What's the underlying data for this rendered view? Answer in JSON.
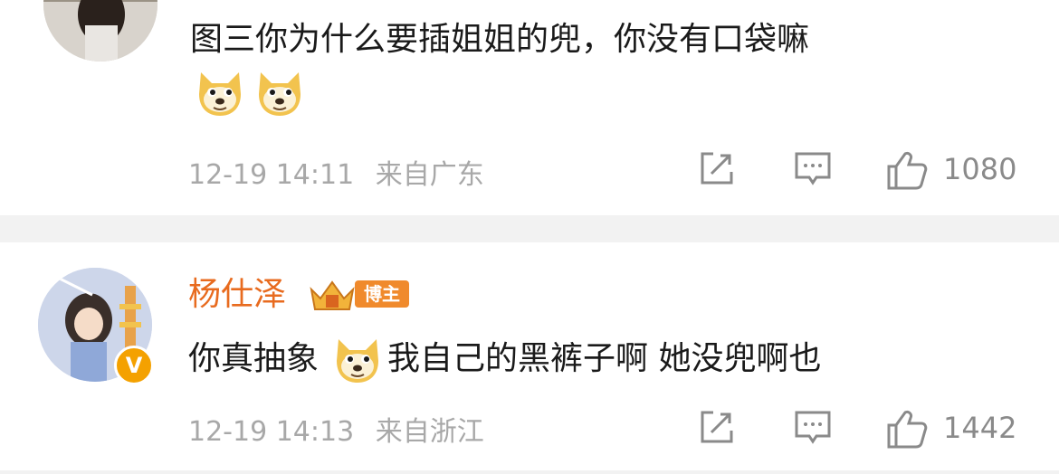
{
  "comments": [
    {
      "text": "图三你为什么要插姐姐的兜，你没有口袋嘛",
      "emojis": [
        "doge-emoji",
        "doge-emoji"
      ],
      "time": "12-19 14:11",
      "location": "来自广东",
      "likes": "1080"
    },
    {
      "username": "杨仕泽",
      "badge_label": "博主",
      "verified_mark": "V",
      "text_before": "你真抽象",
      "emoji": "doge-emoji",
      "text_after": "我自己的黑裤子啊 她没兜啊也",
      "time": "12-19 14:13",
      "location": "来自浙江",
      "likes": "1442"
    }
  ],
  "colors": {
    "username": "#e86b1f",
    "badge_bg": "#f08a2c",
    "verified": "#f4a100",
    "meta_text": "#a8a8a8",
    "icon": "#8a8a8a",
    "divider": "#f2f2f2"
  },
  "icons": [
    "share-icon",
    "comment-icon",
    "like-icon"
  ]
}
